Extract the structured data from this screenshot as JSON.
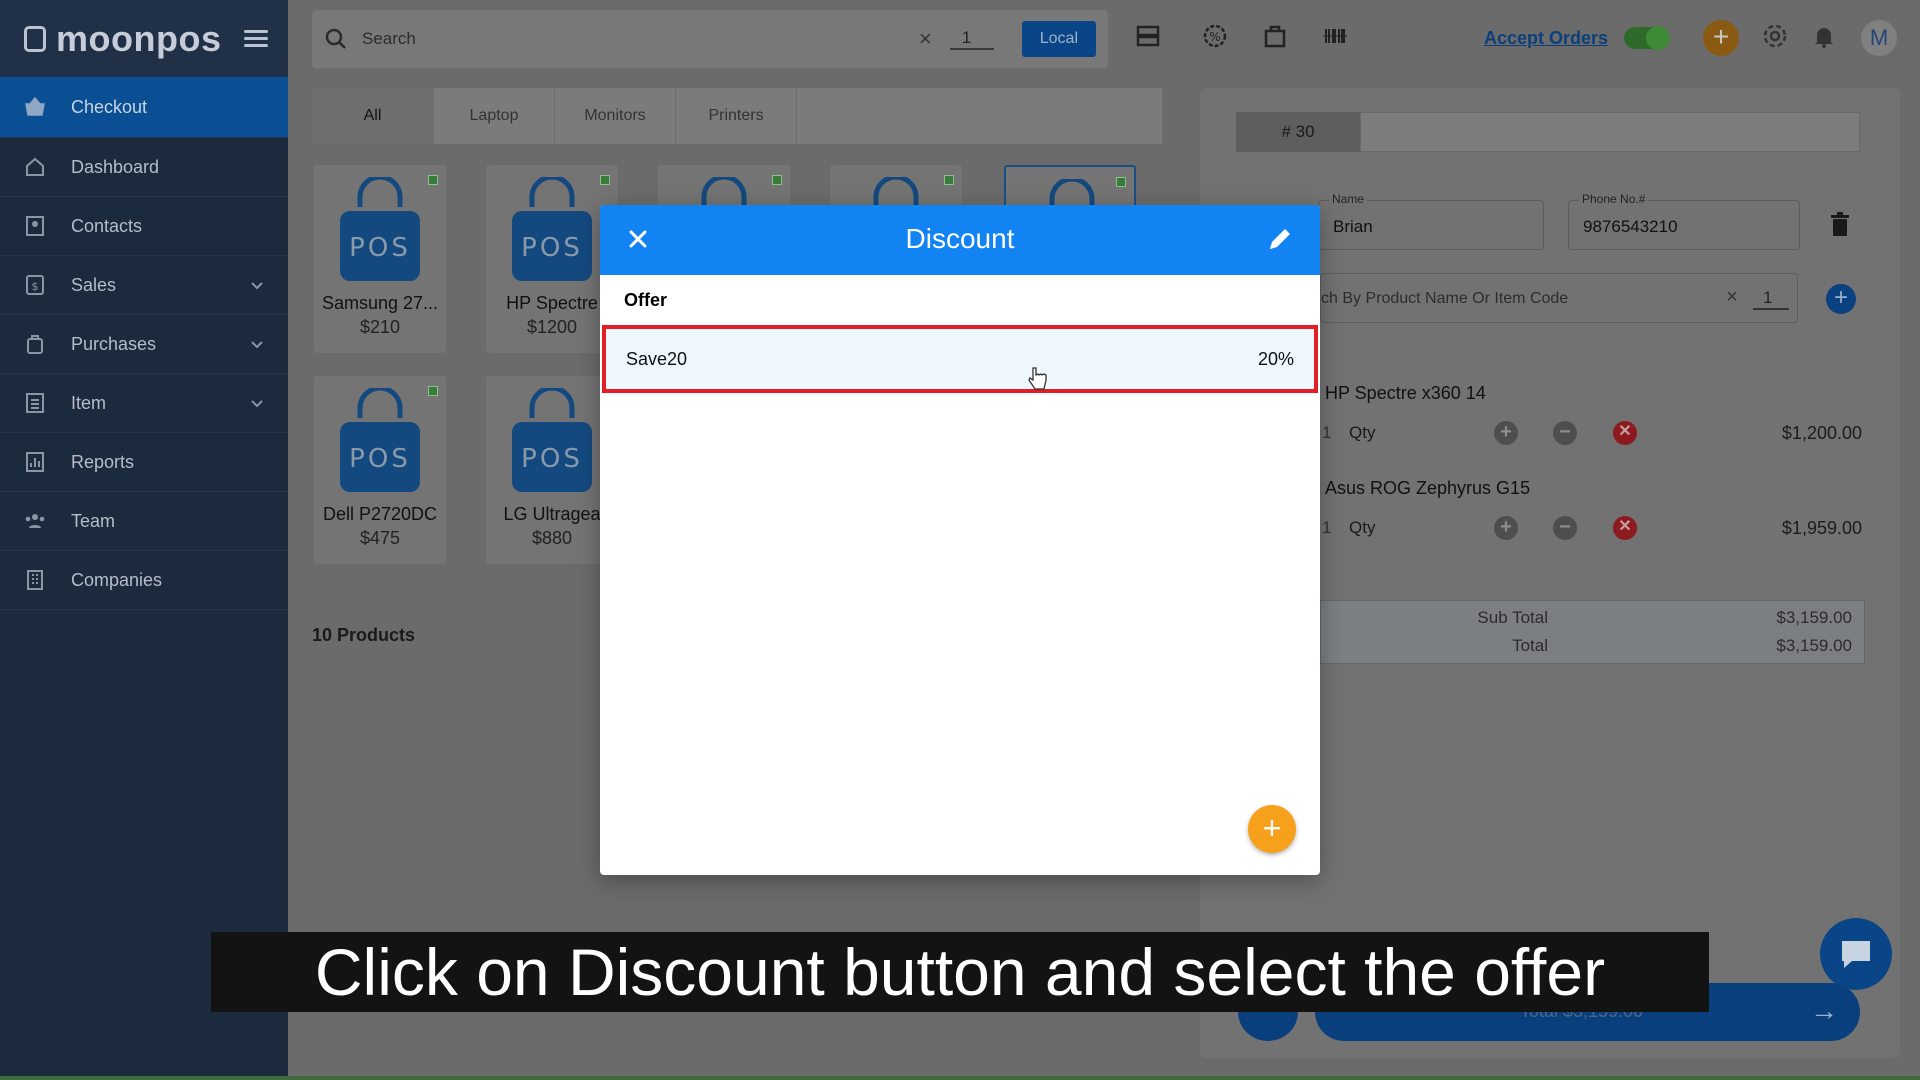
{
  "app": {
    "logo_text": "moonpos",
    "logo_badge": "POS"
  },
  "sidebar": {
    "items": [
      {
        "label": "Checkout",
        "icon": "basket-icon",
        "active": true
      },
      {
        "label": "Dashboard",
        "icon": "home-icon"
      },
      {
        "label": "Contacts",
        "icon": "contacts-icon"
      },
      {
        "label": "Sales",
        "icon": "sales-icon",
        "expandable": true
      },
      {
        "label": "Purchases",
        "icon": "purchases-icon",
        "expandable": true
      },
      {
        "label": "Item",
        "icon": "item-icon",
        "expandable": true
      },
      {
        "label": "Reports",
        "icon": "reports-icon"
      },
      {
        "label": "Team",
        "icon": "team-icon"
      },
      {
        "label": "Companies",
        "icon": "companies-icon"
      }
    ]
  },
  "topbar": {
    "search_placeholder": "Search",
    "qty_value": "1",
    "local_label": "Local",
    "accept_orders_label": "Accept Orders",
    "accept_orders_on": true,
    "avatar_initial": "M"
  },
  "categories": [
    "All",
    "Laptop",
    "Monitors",
    "Printers"
  ],
  "products": [
    {
      "name": "Samsung 27...",
      "price": "$210"
    },
    {
      "name": "HP Spectre",
      "price": "$1200"
    },
    {
      "name": "",
      "price": ""
    },
    {
      "name": "",
      "price": ""
    },
    {
      "name": "",
      "price": ""
    },
    {
      "name": "Dell P2720DC",
      "price": "$475"
    },
    {
      "name": "LG Ultragea",
      "price": "$880"
    }
  ],
  "product_image_text": "POS",
  "product_count_label": "10 Products",
  "order": {
    "number": "# 30",
    "name_label": "Name",
    "name_value": "Brian",
    "phone_label": "Phone No.#",
    "phone_value": "9876543210",
    "product_search_placeholder": "ch By Product Name Or Item Code",
    "product_search_qty": "1",
    "lines": [
      {
        "name": "HP Spectre x360 14",
        "qty": "1",
        "qty_label": "Qty",
        "price": "$1,200.00"
      },
      {
        "name": "Asus ROG Zephyrus G15",
        "qty": "1",
        "qty_label": "Qty",
        "price": "$1,959.00"
      }
    ],
    "sub_total_label": "Sub Total",
    "sub_total_value": "$3,159.00",
    "total_label": "Total",
    "total_value": "$3,159.00",
    "pay_label": "Total $3,159.00"
  },
  "modal": {
    "title": "Discount",
    "column_header": "Offer",
    "offers": [
      {
        "name": "Save20",
        "value": "20%",
        "highlighted": true
      }
    ],
    "add_label": "+"
  },
  "caption": "Click on Discount button and select the offer",
  "colors": {
    "accent_blue": "#1283f2",
    "highlight_red": "#e01f26",
    "fab_orange": "#f7a01c",
    "sidebar_bg": "#1c2a3e"
  }
}
